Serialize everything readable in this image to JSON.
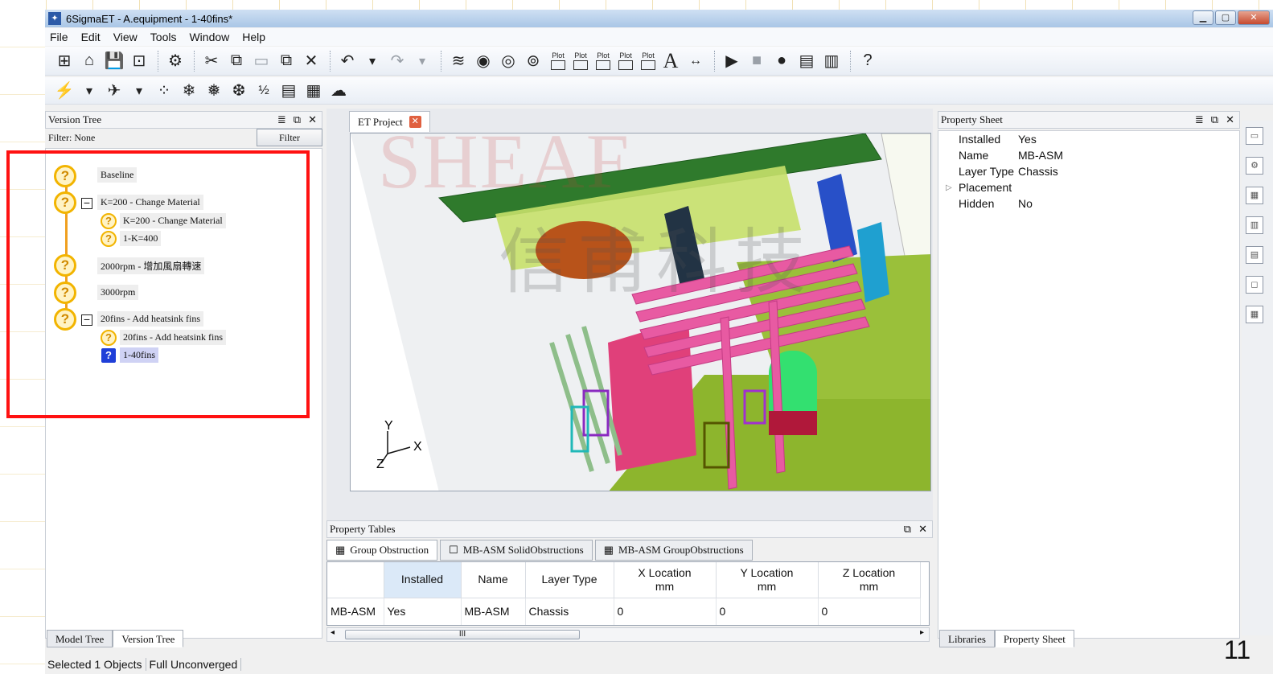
{
  "window": {
    "title": "6SigmaET - A.equipment - 1-40fins*",
    "app_icon": "6sigmaet-logo-icon",
    "controls": [
      "minimize",
      "maximize",
      "close"
    ]
  },
  "menu": [
    "File",
    "Edit",
    "View",
    "Tools",
    "Window",
    "Help"
  ],
  "toolbar": {
    "plot_label": "Plot",
    "text_tool": "A"
  },
  "version_tree": {
    "title": "Version Tree",
    "filter_label": "Filter: None",
    "filter_button": "Filter",
    "nodes": [
      {
        "label": "Baseline",
        "level": 0
      },
      {
        "label": "K=200 - Change Material",
        "level": 0,
        "expanded": true
      },
      {
        "label": "K=200 - Change Material",
        "level": 1
      },
      {
        "label": "1-K=400",
        "level": 1
      },
      {
        "label": "2000rpm - 增加風扇轉速",
        "level": 0
      },
      {
        "label": "3000rpm",
        "level": 0
      },
      {
        "label": "20fins - Add heatsink fins",
        "level": 0,
        "expanded": true
      },
      {
        "label": "20fins - Add heatsink fins",
        "level": 1
      },
      {
        "label": "1-40fins",
        "level": 1,
        "selected": true
      }
    ],
    "bottom_tabs": [
      "Model Tree",
      "Version Tree"
    ],
    "active_bottom_tab": "Version Tree",
    "highlight_color": "#ff1111"
  },
  "project": {
    "tab_label": "ET Project",
    "axis_labels": {
      "y": "Y",
      "x": "X",
      "z": "Z"
    }
  },
  "watermark": {
    "brand": "SHEAF",
    "chinese": "信甫科技"
  },
  "property_tables": {
    "title": "Property Tables",
    "tabs": [
      "Group Obstruction",
      "MB-ASM SolidObstructions",
      "MB-ASM GroupObstructions"
    ],
    "active_tab": "Group Obstruction",
    "columns": [
      {
        "label": "",
        "unit": ""
      },
      {
        "label": "Installed",
        "unit": ""
      },
      {
        "label": "Name",
        "unit": ""
      },
      {
        "label": "Layer Type",
        "unit": ""
      },
      {
        "label": "X Location",
        "unit": "mm"
      },
      {
        "label": "Y Location",
        "unit": "mm"
      },
      {
        "label": "Z Location",
        "unit": "mm"
      }
    ],
    "rows": [
      [
        "MB-ASM",
        "Yes",
        "MB-ASM",
        "Chassis",
        "0",
        "0",
        "0"
      ]
    ],
    "scroll_thumb_label": "III"
  },
  "property_sheet": {
    "title": "Property Sheet",
    "rows": [
      {
        "key": "Installed",
        "value": "Yes"
      },
      {
        "key": "Name",
        "value": "MB-ASM"
      },
      {
        "key": "Layer Type",
        "value": "Chassis"
      },
      {
        "key": "Placement",
        "value": "",
        "expandable": true
      },
      {
        "key": "Hidden",
        "value": "No"
      }
    ],
    "bottom_tabs": [
      "Libraries",
      "Property Sheet"
    ],
    "active_bottom_tab": "Property Sheet"
  },
  "status": {
    "selected": "Selected 1 Objects",
    "solve_state": "Full Unconverged"
  },
  "slide_number": "11"
}
